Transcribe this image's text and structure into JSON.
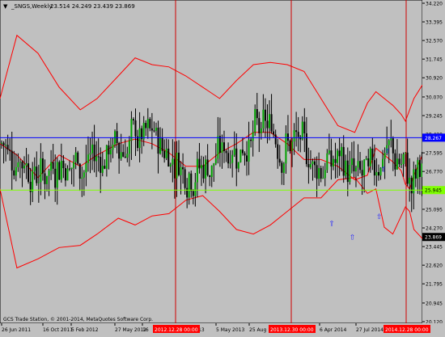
{
  "header": {
    "symbol": "_SNGS,Weekly",
    "ohlc": "23.514 24.249 23.439 23.869"
  },
  "footer_note": "GCS Trade Station, © 2001-2014, MetaQuotes Software Corp.",
  "colors": {
    "background": "#c0c0c0",
    "bull_candle": "#00a000",
    "bear_candle": "#000000",
    "bollinger": "#ff0000",
    "vertical_marker": "#d00000",
    "hline_blue": "#0000ff",
    "hline_green": "#7fff00",
    "arrow": "#2020ff",
    "price_tag_blue_bg": "#0000ff",
    "price_tag_green_bg": "#7fff00",
    "date_tag_bg": "#ff0000"
  },
  "chart_data": {
    "type": "candlestick",
    "title": "_SNGS,Weekly",
    "price_axis_ticks": [
      "34.220",
      "33.395",
      "32.570",
      "31.745",
      "30.920",
      "30.070",
      "29.245",
      "28.420",
      "27.595",
      "26.770",
      "25.945",
      "25.095",
      "24.270",
      "23.445",
      "22.620",
      "21.795",
      "20.945",
      "20.120"
    ],
    "ylim": [
      20.12,
      34.22
    ],
    "date_axis_ticks": [
      "26 Jun 2011",
      "16 Oct 2011",
      "5 Feb 2012",
      "27 May 2012",
      "16",
      "5 May 2013",
      "25 Aug",
      "6 Apr 2014",
      "27 Jul 2014"
    ],
    "date_tags": [
      "2012.12.28 00:00",
      "2013.12.30 00:00",
      "2014.12.28 00:00"
    ],
    "hlines": [
      {
        "value": 28.267,
        "label": "28.267",
        "color": "#0000ff"
      },
      {
        "value": 25.945,
        "label": "25.945",
        "color": "#7fff00"
      }
    ],
    "current_price": {
      "value": 23.869,
      "label": "23.869"
    },
    "up_arrows": [
      {
        "index": 160,
        "value": 24.5
      },
      {
        "index": 170,
        "value": 23.9
      },
      {
        "index": 187,
        "value": 27.7
      },
      {
        "index": 185,
        "value": 26.9
      },
      {
        "index": 183,
        "value": 24.8
      }
    ],
    "bollinger_bands": {
      "upper": [
        30.0,
        32.8,
        32.0,
        30.5,
        29.5,
        30.0,
        31.0,
        31.8,
        31.5,
        31.4,
        31.0,
        30.5,
        30.0,
        30.8,
        31.5,
        31.6,
        31.5,
        31.2,
        30.0,
        28.8,
        28.5,
        29.8,
        30.3,
        30.0,
        29.7,
        29.3,
        29.0,
        29.5,
        30.0,
        30.6
      ],
      "middle": [
        28.0,
        27.5,
        26.5,
        27.5,
        27.0,
        27.5,
        28.0,
        28.2,
        28.0,
        27.6,
        27.0,
        27.0,
        27.6,
        28.0,
        28.5,
        28.5,
        28.0,
        27.3,
        27.3,
        27.0,
        26.4,
        26.6,
        27.8,
        27.5,
        27.2,
        26.8,
        26.2,
        26.0,
        26.6,
        27.5
      ],
      "lower": [
        26.0,
        22.5,
        22.9,
        23.4,
        23.5,
        24.0,
        24.7,
        24.4,
        24.8,
        24.9,
        25.5,
        25.7,
        25.0,
        24.2,
        24.0,
        24.4,
        25.0,
        25.6,
        25.6,
        26.4,
        26.5,
        25.8,
        26.0,
        24.3,
        24.0,
        24.8,
        25.2,
        25.0,
        24.2,
        23.8
      ],
      "x_fraction": [
        0.0,
        0.04,
        0.09,
        0.14,
        0.19,
        0.23,
        0.28,
        0.32,
        0.36,
        0.4,
        0.44,
        0.48,
        0.52,
        0.56,
        0.6,
        0.64,
        0.68,
        0.72,
        0.76,
        0.8,
        0.84,
        0.87,
        0.89,
        0.91,
        0.93,
        0.95,
        0.96,
        0.97,
        0.98,
        1.0
      ]
    },
    "candles_pattern": "synthetic weekly bars ~200, read from image"
  }
}
